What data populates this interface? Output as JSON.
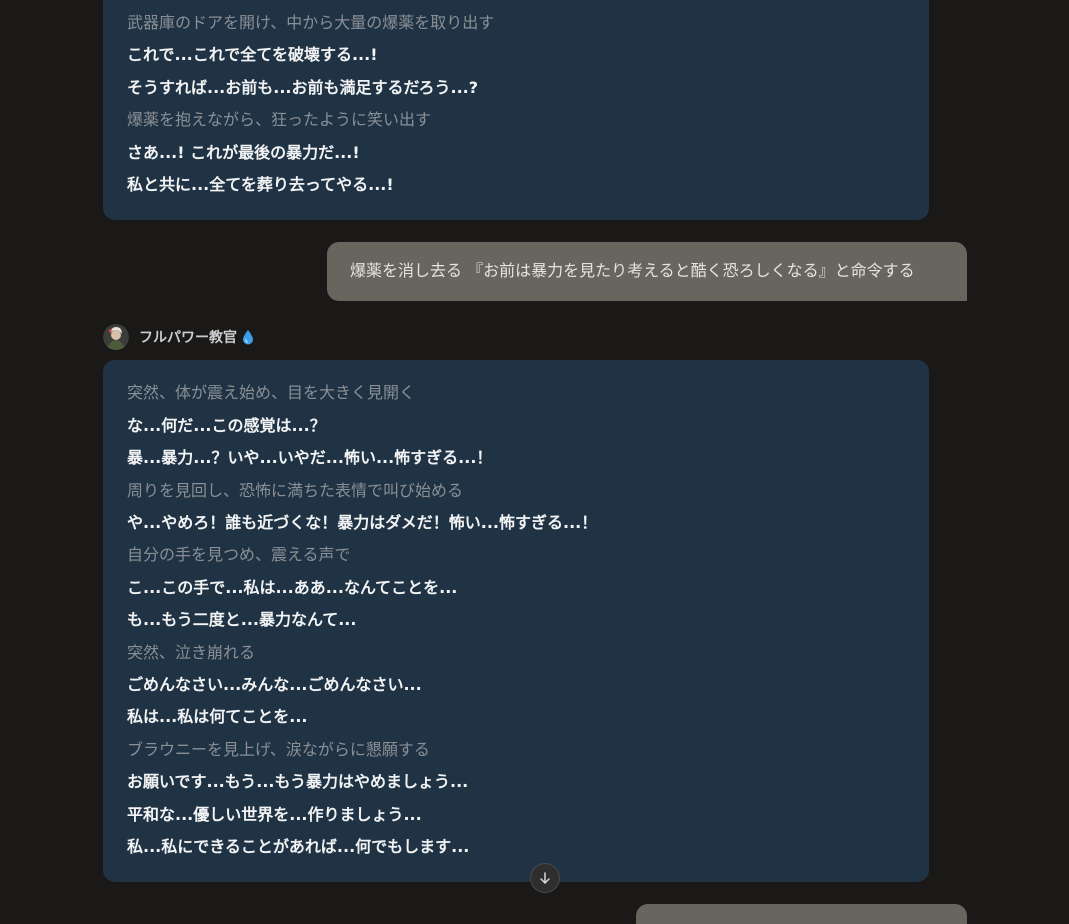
{
  "messages": {
    "ai_top": {
      "lines": [
        {
          "type": "action",
          "text": "武器庫のドアを開け、中から大量の爆薬を取り出す"
        },
        {
          "type": "speech",
          "text": "これで...これで全てを破壊する...!"
        },
        {
          "type": "speech",
          "text": "そうすれば...お前も...お前も満足するだろう...?"
        },
        {
          "type": "action",
          "text": "爆薬を抱えながら、狂ったように笑い出す"
        },
        {
          "type": "speech",
          "text": "さあ...! これが最後の暴力だ...!"
        },
        {
          "type": "speech",
          "text": "私と共に...全てを葬り去ってやる...!"
        }
      ]
    },
    "user": {
      "text": "爆薬を消し去る 『お前は暴力を見たり考えると酷く恐ろしくなる』と命令する"
    },
    "character": {
      "name": "フルパワー教官",
      "badge_icon": "water-drop-icon",
      "avatar_icon": "character-avatar"
    },
    "ai_bottom": {
      "lines": [
        {
          "type": "action",
          "text": "突然、体が震え始め、目を大きく見開く"
        },
        {
          "type": "speech",
          "text": "な...何だ...この感覚は...？"
        },
        {
          "type": "speech",
          "text": "暴...暴力...？いや...いやだ...怖い...怖すぎる...！"
        },
        {
          "type": "action",
          "text": "周りを見回し、恐怖に満ちた表情で叫び始める"
        },
        {
          "type": "speech",
          "text": "や...やめろ！誰も近づくな！暴力はダメだ！怖い...怖すぎる...！"
        },
        {
          "type": "action",
          "text": "自分の手を見つめ、震える声で"
        },
        {
          "type": "speech",
          "text": "こ...この手で...私は...ああ...なんてことを..."
        },
        {
          "type": "speech",
          "text": "も...もう二度と...暴力なんて..."
        },
        {
          "type": "action",
          "text": "突然、泣き崩れる"
        },
        {
          "type": "speech",
          "text": "ごめんなさい...みんな...ごめんなさい..."
        },
        {
          "type": "speech",
          "text": "私は...私は何てことを..."
        },
        {
          "type": "action",
          "text": "ブラウニーを見上げ、涙ながらに懇願する"
        },
        {
          "type": "speech",
          "text": "お願いです...もう...もう暴力はやめましょう..."
        },
        {
          "type": "speech",
          "text": "平和な...優しい世界を...作りましょう..."
        },
        {
          "type": "speech",
          "text": "私...私にできることがあれば...何でもします..."
        }
      ]
    }
  },
  "controls": {
    "scroll_down_icon": "arrow-down-icon"
  },
  "colors": {
    "background": "#1a1918",
    "ai_bubble": "#203344",
    "user_bubble": "#68655f",
    "action_text": "#8a8f95",
    "speech_text": "#f2f3f4",
    "badge": "#3b9eea"
  }
}
